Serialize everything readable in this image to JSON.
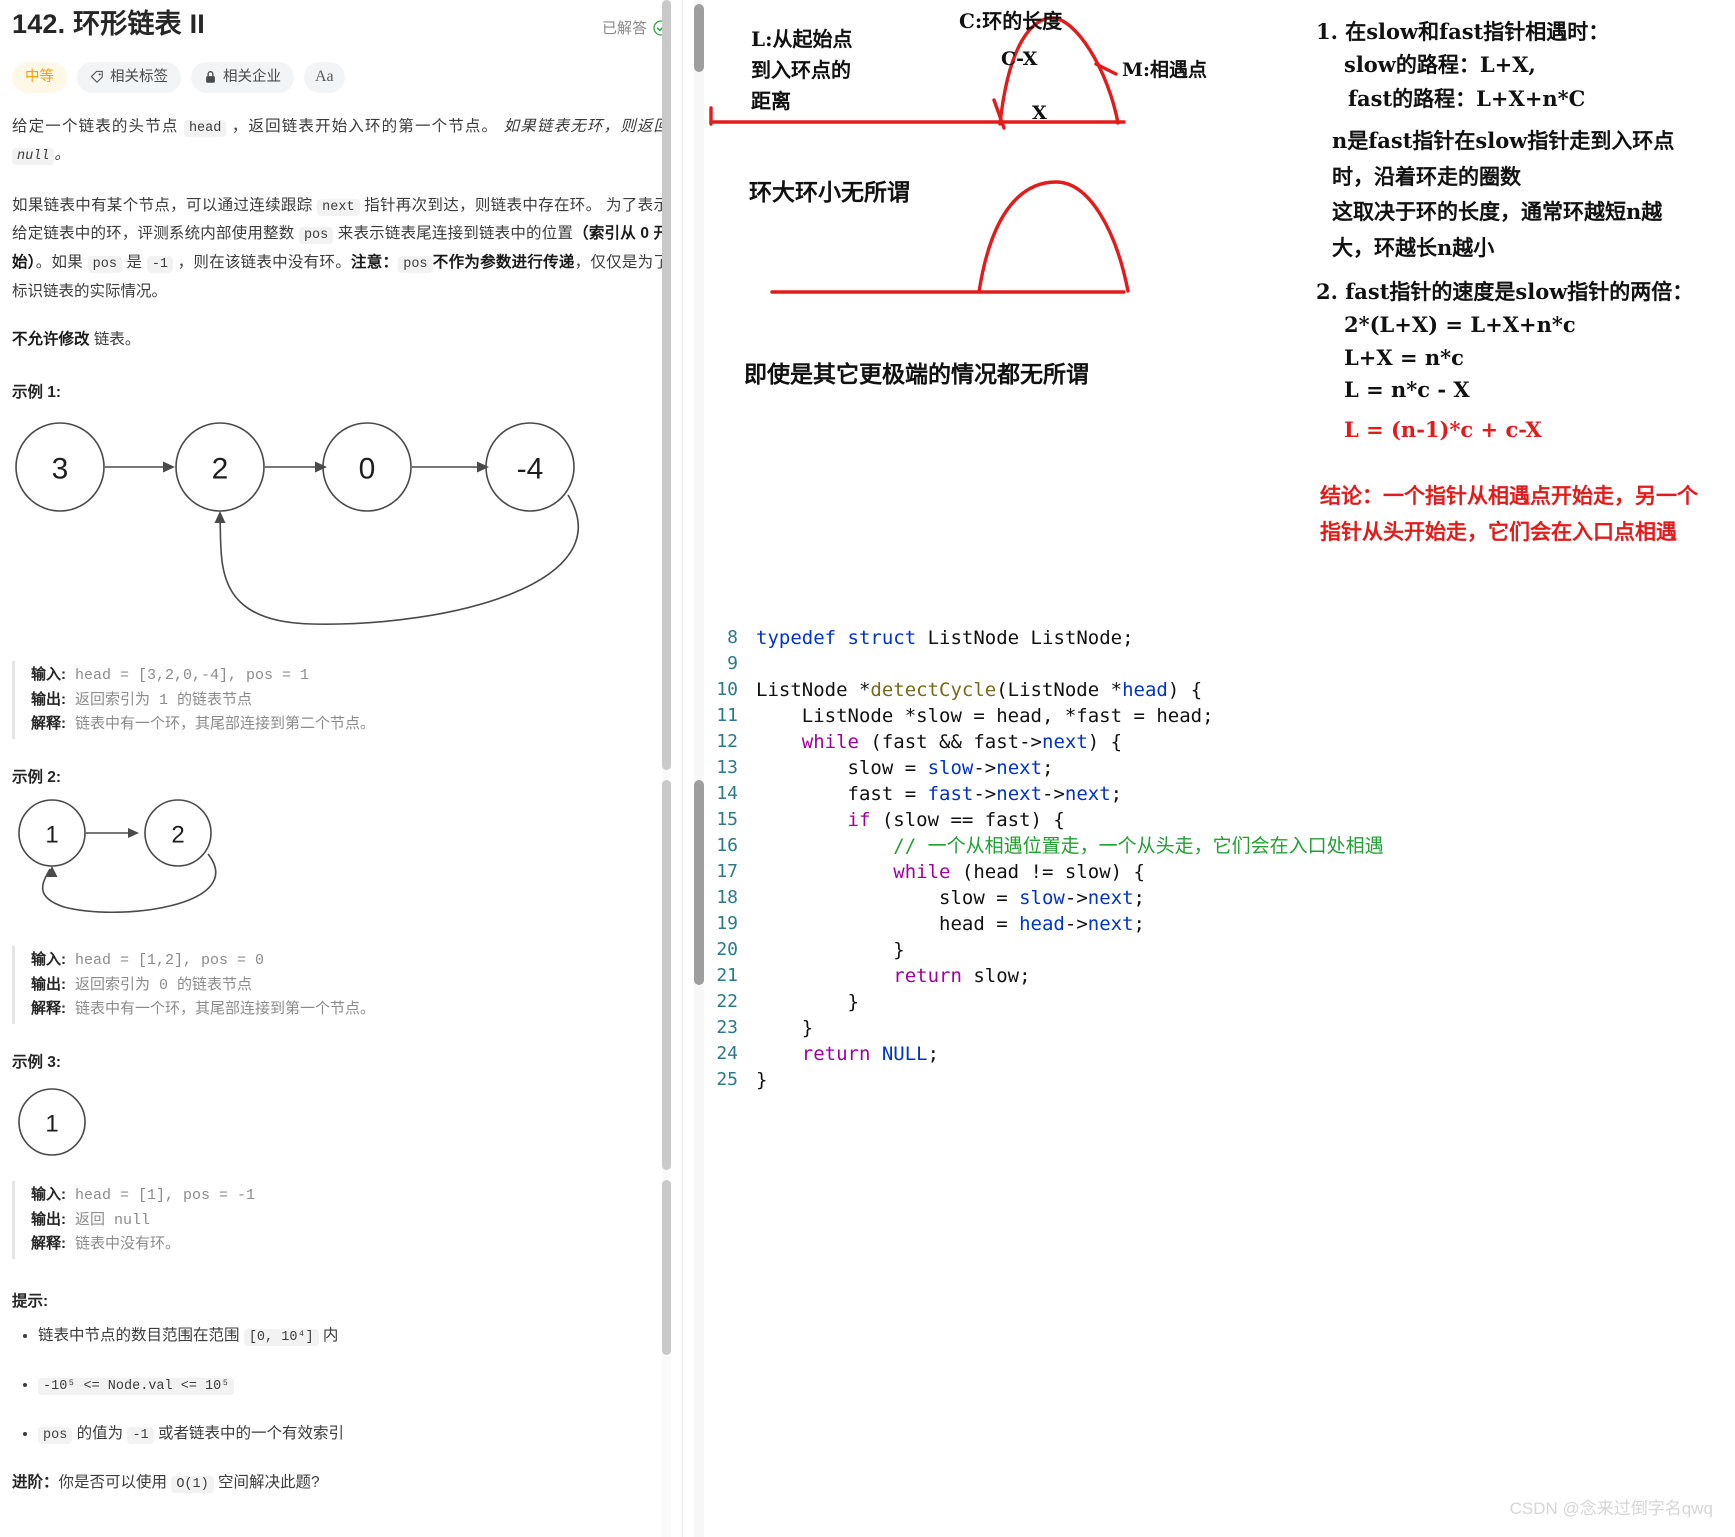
{
  "problem": {
    "title_number": "142.",
    "title_text": "环形链表 II",
    "solved_label": "已解答",
    "tags": [
      {
        "name": "difficulty",
        "label": "中等",
        "icon": "none"
      },
      {
        "name": "related-tags",
        "label": "相关标签",
        "icon": "tag-icon"
      },
      {
        "name": "related-companies",
        "label": "相关企业",
        "icon": "lock-icon"
      },
      {
        "name": "font-size",
        "label": "Aa",
        "icon": "font-size-icon"
      }
    ],
    "paragraph1": {
      "a": "给定一个链表的头节点 ",
      "code1": "head",
      "b": " ，返回链表开始入环的第一个节点。 ",
      "italic1": "如果链表无环，则返回 ",
      "code2": "null",
      "italic2": "。"
    },
    "paragraph2": {
      "a": "如果链表中有某个节点，可以通过连续跟踪 ",
      "code1": "next",
      "b": " 指针再次到达，则链表中存在环。 为了表示给定链表中的环，评测系统内部使用整数 ",
      "code2": "pos",
      "c": " 来表示链表尾连接到链表中的位置",
      "bold1": "（索引从 0 开始）",
      "d": "。如果 ",
      "code3": "pos",
      "e": " 是 ",
      "code4": "-1",
      "f": " ，则在该链表中没有环。",
      "bold2": "注意：",
      "code5": "pos",
      "bold3": "不作为参数进行传递",
      "g": "，仅仅是为了标识链表的实际情况。"
    },
    "paragraph3": {
      "bold": "不允许修改",
      "rest": " 链表。"
    },
    "examples": [
      {
        "heading": "示例 1:",
        "figure": "linked-list-cycle-4nodes",
        "nodes": [
          "3",
          "2",
          "0",
          "-4"
        ],
        "rows": [
          {
            "label": "输入:",
            "value": "head = [3,2,0,-4], pos = 1"
          },
          {
            "label": "输出:",
            "value": "返回索引为 1 的链表节点"
          },
          {
            "label": "解释:",
            "value": "链表中有一个环，其尾部连接到第二个节点。"
          }
        ]
      },
      {
        "heading": "示例 2:",
        "figure": "linked-list-cycle-2nodes",
        "nodes": [
          "1",
          "2"
        ],
        "rows": [
          {
            "label": "输入:",
            "value": "head = [1,2], pos = 0"
          },
          {
            "label": "输出:",
            "value": "返回索引为 0 的链表节点"
          },
          {
            "label": "解释:",
            "value": "链表中有一个环，其尾部连接到第一个节点。"
          }
        ]
      },
      {
        "heading": "示例 3:",
        "figure": "linked-list-single-node",
        "nodes": [
          "1"
        ],
        "rows": [
          {
            "label": "输入:",
            "value": "head = [1], pos = -1"
          },
          {
            "label": "输出:",
            "value": "返回 null"
          },
          {
            "label": "解释:",
            "value": "链表中没有环。"
          }
        ]
      }
    ],
    "hints_heading": "提示:",
    "hints": [
      {
        "a": "链表中节点的数目范围在范围 ",
        "code": "[0, 10⁴]",
        "b": " 内"
      },
      {
        "a": "",
        "code": "-10⁵ <= Node.val <= 10⁵",
        "b": ""
      },
      {
        "a": "",
        "code": "pos",
        "b": " 的值为 ",
        "code2": "-1",
        "c": " 或者链表中的一个有效索引"
      }
    ],
    "advanced": {
      "label": "进阶：",
      "a": "你是否可以使用 ",
      "code": "O(1)",
      "b": " 空间解决此题?"
    }
  },
  "notes": {
    "diagram1": {
      "label_L": "L:从起始点\n到入环点的\n距离",
      "label_C": "C:环的长度",
      "label_CX": "C-X",
      "label_M": "M:相遇点",
      "label_X": "X"
    },
    "diagram2": {
      "label": "环大环小无所谓",
      "caption": "即使是其它更极端的情况都无所谓"
    },
    "right_notes": {
      "item1_head": "1. 在slow和fast指针相遇时：",
      "item1_l1": "slow的路程：L+X,",
      "item1_l2": "fast的路程：L+X+n*C",
      "item1_p1": "n是fast指针在slow指针走到入环点\n时，沿着环走的圈数",
      "item1_p2": "这取决于环的长度，通常环越短n越\n大，环越长n越小",
      "item2_head": "2. fast指针的速度是slow指针的两倍：",
      "item2_l1": "2*(L+X) = L+X+n*c",
      "item2_l2": "L+X = n*c",
      "item2_l3": "L = n*c - X",
      "item2_l4_red": "L = (n-1)*c + c-X",
      "conclusion": "结论：一个指针从相遇点开始走，另一个\n指针从头开始走，它们会在入口点相遇"
    }
  },
  "code": {
    "language": "c",
    "lines": [
      {
        "n": "8",
        "tokens": [
          {
            "t": "typedef",
            "c": "k"
          },
          {
            "t": " ",
            "c": ""
          },
          {
            "t": "struct",
            "c": "k"
          },
          {
            "t": " ListNode ListNode;",
            "c": ""
          }
        ]
      },
      {
        "n": "9",
        "tokens": []
      },
      {
        "n": "10",
        "tokens": [
          {
            "t": "ListNode *",
            "c": ""
          },
          {
            "t": "detectCycle",
            "c": "fn"
          },
          {
            "t": "(ListNode *",
            "c": ""
          },
          {
            "t": "head",
            "c": "var"
          },
          {
            "t": ") {",
            "c": ""
          }
        ]
      },
      {
        "n": "11",
        "tokens": [
          {
            "t": "    ListNode *slow = head, *fast = head;",
            "c": ""
          }
        ]
      },
      {
        "n": "12",
        "tokens": [
          {
            "t": "    ",
            "c": ""
          },
          {
            "t": "while",
            "c": "kw"
          },
          {
            "t": " (fast && fast->",
            "c": ""
          },
          {
            "t": "next",
            "c": "var"
          },
          {
            "t": ") {",
            "c": ""
          }
        ]
      },
      {
        "n": "13",
        "tokens": [
          {
            "t": "        slow = ",
            "c": ""
          },
          {
            "t": "slow",
            "c": "var"
          },
          {
            "t": "->",
            "c": ""
          },
          {
            "t": "next",
            "c": "var"
          },
          {
            "t": ";",
            "c": ""
          }
        ]
      },
      {
        "n": "14",
        "tokens": [
          {
            "t": "        fast = ",
            "c": ""
          },
          {
            "t": "fast",
            "c": "var"
          },
          {
            "t": "->",
            "c": ""
          },
          {
            "t": "next",
            "c": "var"
          },
          {
            "t": "->",
            "c": ""
          },
          {
            "t": "next",
            "c": "var"
          },
          {
            "t": ";",
            "c": ""
          }
        ]
      },
      {
        "n": "15",
        "tokens": [
          {
            "t": "        ",
            "c": ""
          },
          {
            "t": "if",
            "c": "kw"
          },
          {
            "t": " (slow == fast) {",
            "c": ""
          }
        ]
      },
      {
        "n": "16",
        "tokens": [
          {
            "t": "            ",
            "c": ""
          },
          {
            "t": "// 一个从相遇位置走，一个从头走，它们会在入口处相遇",
            "c": "cm"
          }
        ]
      },
      {
        "n": "17",
        "tokens": [
          {
            "t": "            ",
            "c": ""
          },
          {
            "t": "while",
            "c": "kw"
          },
          {
            "t": " (head != slow) {",
            "c": ""
          }
        ]
      },
      {
        "n": "18",
        "tokens": [
          {
            "t": "                slow = ",
            "c": ""
          },
          {
            "t": "slow",
            "c": "var"
          },
          {
            "t": "->",
            "c": ""
          },
          {
            "t": "next",
            "c": "var"
          },
          {
            "t": ";",
            "c": ""
          }
        ]
      },
      {
        "n": "19",
        "tokens": [
          {
            "t": "                head = ",
            "c": ""
          },
          {
            "t": "head",
            "c": "var"
          },
          {
            "t": "->",
            "c": ""
          },
          {
            "t": "next",
            "c": "var"
          },
          {
            "t": ";",
            "c": ""
          }
        ]
      },
      {
        "n": "20",
        "tokens": [
          {
            "t": "            }",
            "c": ""
          }
        ]
      },
      {
        "n": "21",
        "tokens": [
          {
            "t": "            ",
            "c": ""
          },
          {
            "t": "return",
            "c": "kw"
          },
          {
            "t": " slow;",
            "c": ""
          }
        ]
      },
      {
        "n": "22",
        "tokens": [
          {
            "t": "        }",
            "c": ""
          }
        ]
      },
      {
        "n": "23",
        "tokens": [
          {
            "t": "    }",
            "c": ""
          }
        ]
      },
      {
        "n": "24",
        "tokens": [
          {
            "t": "    ",
            "c": ""
          },
          {
            "t": "return",
            "c": "kw"
          },
          {
            "t": " ",
            "c": ""
          },
          {
            "t": "NULL",
            "c": "k"
          },
          {
            "t": ";",
            "c": ""
          }
        ]
      },
      {
        "n": "25",
        "tokens": [
          {
            "t": "}",
            "c": ""
          }
        ]
      }
    ]
  },
  "watermark": "CSDN @念来过倒字名qwq",
  "colors": {
    "accent_red": "#e21b1b",
    "difficulty": "#f0a010",
    "code_keyword": "#a100a1",
    "code_type": "#0033cc",
    "code_function": "#7a6a18",
    "code_comment": "#22a033",
    "line_number": "#2b7a8c"
  }
}
